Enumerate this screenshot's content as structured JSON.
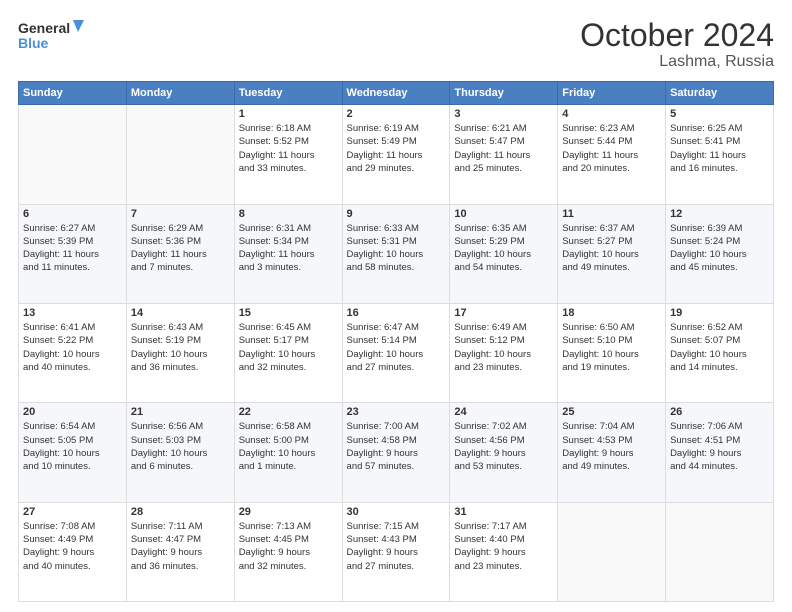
{
  "header": {
    "logo_line1": "General",
    "logo_line2": "Blue",
    "title": "October 2024",
    "subtitle": "Lashma, Russia"
  },
  "weekdays": [
    "Sunday",
    "Monday",
    "Tuesday",
    "Wednesday",
    "Thursday",
    "Friday",
    "Saturday"
  ],
  "weeks": [
    [
      {
        "day": "",
        "info": ""
      },
      {
        "day": "",
        "info": ""
      },
      {
        "day": "1",
        "info": "Sunrise: 6:18 AM\nSunset: 5:52 PM\nDaylight: 11 hours\nand 33 minutes."
      },
      {
        "day": "2",
        "info": "Sunrise: 6:19 AM\nSunset: 5:49 PM\nDaylight: 11 hours\nand 29 minutes."
      },
      {
        "day": "3",
        "info": "Sunrise: 6:21 AM\nSunset: 5:47 PM\nDaylight: 11 hours\nand 25 minutes."
      },
      {
        "day": "4",
        "info": "Sunrise: 6:23 AM\nSunset: 5:44 PM\nDaylight: 11 hours\nand 20 minutes."
      },
      {
        "day": "5",
        "info": "Sunrise: 6:25 AM\nSunset: 5:41 PM\nDaylight: 11 hours\nand 16 minutes."
      }
    ],
    [
      {
        "day": "6",
        "info": "Sunrise: 6:27 AM\nSunset: 5:39 PM\nDaylight: 11 hours\nand 11 minutes."
      },
      {
        "day": "7",
        "info": "Sunrise: 6:29 AM\nSunset: 5:36 PM\nDaylight: 11 hours\nand 7 minutes."
      },
      {
        "day": "8",
        "info": "Sunrise: 6:31 AM\nSunset: 5:34 PM\nDaylight: 11 hours\nand 3 minutes."
      },
      {
        "day": "9",
        "info": "Sunrise: 6:33 AM\nSunset: 5:31 PM\nDaylight: 10 hours\nand 58 minutes."
      },
      {
        "day": "10",
        "info": "Sunrise: 6:35 AM\nSunset: 5:29 PM\nDaylight: 10 hours\nand 54 minutes."
      },
      {
        "day": "11",
        "info": "Sunrise: 6:37 AM\nSunset: 5:27 PM\nDaylight: 10 hours\nand 49 minutes."
      },
      {
        "day": "12",
        "info": "Sunrise: 6:39 AM\nSunset: 5:24 PM\nDaylight: 10 hours\nand 45 minutes."
      }
    ],
    [
      {
        "day": "13",
        "info": "Sunrise: 6:41 AM\nSunset: 5:22 PM\nDaylight: 10 hours\nand 40 minutes."
      },
      {
        "day": "14",
        "info": "Sunrise: 6:43 AM\nSunset: 5:19 PM\nDaylight: 10 hours\nand 36 minutes."
      },
      {
        "day": "15",
        "info": "Sunrise: 6:45 AM\nSunset: 5:17 PM\nDaylight: 10 hours\nand 32 minutes."
      },
      {
        "day": "16",
        "info": "Sunrise: 6:47 AM\nSunset: 5:14 PM\nDaylight: 10 hours\nand 27 minutes."
      },
      {
        "day": "17",
        "info": "Sunrise: 6:49 AM\nSunset: 5:12 PM\nDaylight: 10 hours\nand 23 minutes."
      },
      {
        "day": "18",
        "info": "Sunrise: 6:50 AM\nSunset: 5:10 PM\nDaylight: 10 hours\nand 19 minutes."
      },
      {
        "day": "19",
        "info": "Sunrise: 6:52 AM\nSunset: 5:07 PM\nDaylight: 10 hours\nand 14 minutes."
      }
    ],
    [
      {
        "day": "20",
        "info": "Sunrise: 6:54 AM\nSunset: 5:05 PM\nDaylight: 10 hours\nand 10 minutes."
      },
      {
        "day": "21",
        "info": "Sunrise: 6:56 AM\nSunset: 5:03 PM\nDaylight: 10 hours\nand 6 minutes."
      },
      {
        "day": "22",
        "info": "Sunrise: 6:58 AM\nSunset: 5:00 PM\nDaylight: 10 hours\nand 1 minute."
      },
      {
        "day": "23",
        "info": "Sunrise: 7:00 AM\nSunset: 4:58 PM\nDaylight: 9 hours\nand 57 minutes."
      },
      {
        "day": "24",
        "info": "Sunrise: 7:02 AM\nSunset: 4:56 PM\nDaylight: 9 hours\nand 53 minutes."
      },
      {
        "day": "25",
        "info": "Sunrise: 7:04 AM\nSunset: 4:53 PM\nDaylight: 9 hours\nand 49 minutes."
      },
      {
        "day": "26",
        "info": "Sunrise: 7:06 AM\nSunset: 4:51 PM\nDaylight: 9 hours\nand 44 minutes."
      }
    ],
    [
      {
        "day": "27",
        "info": "Sunrise: 7:08 AM\nSunset: 4:49 PM\nDaylight: 9 hours\nand 40 minutes."
      },
      {
        "day": "28",
        "info": "Sunrise: 7:11 AM\nSunset: 4:47 PM\nDaylight: 9 hours\nand 36 minutes."
      },
      {
        "day": "29",
        "info": "Sunrise: 7:13 AM\nSunset: 4:45 PM\nDaylight: 9 hours\nand 32 minutes."
      },
      {
        "day": "30",
        "info": "Sunrise: 7:15 AM\nSunset: 4:43 PM\nDaylight: 9 hours\nand 27 minutes."
      },
      {
        "day": "31",
        "info": "Sunrise: 7:17 AM\nSunset: 4:40 PM\nDaylight: 9 hours\nand 23 minutes."
      },
      {
        "day": "",
        "info": ""
      },
      {
        "day": "",
        "info": ""
      }
    ]
  ]
}
